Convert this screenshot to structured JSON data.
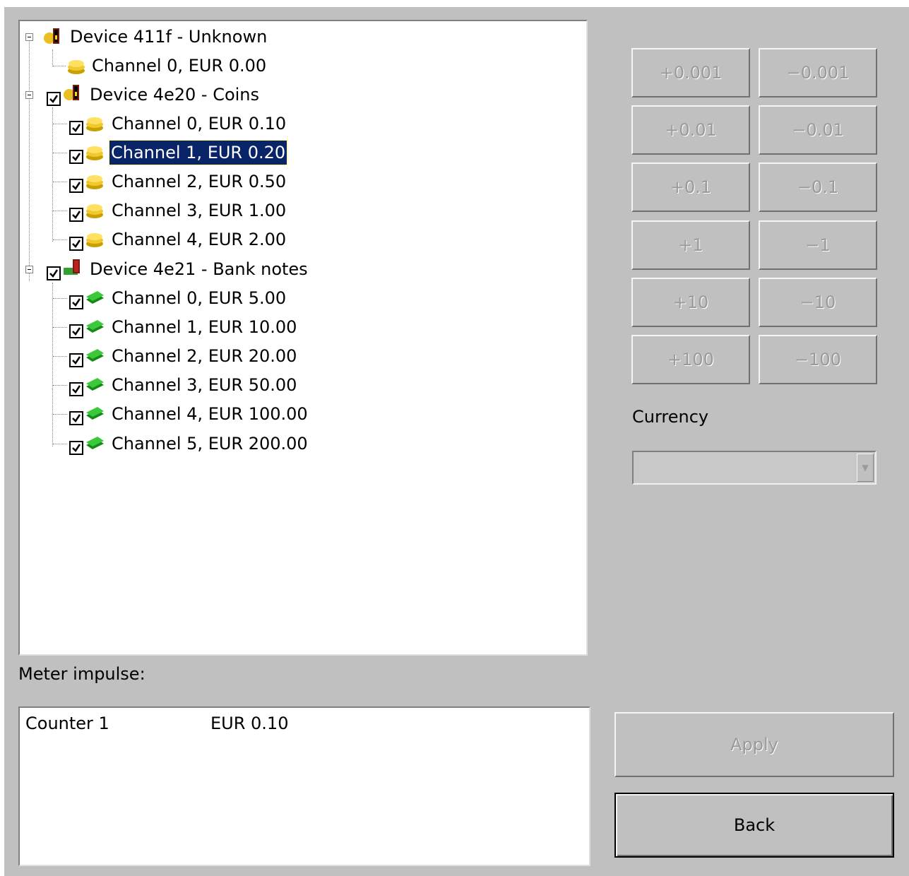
{
  "tree": {
    "devices": [
      {
        "label": "Device 411f - Unknown",
        "checkbox": false,
        "icon": "coin-device-icon",
        "channels": [
          {
            "label": "Channel 0, EUR 0.00",
            "checkbox": false,
            "icon": "coins-icon"
          }
        ]
      },
      {
        "label": "Device 4e20 - Coins",
        "checkbox": true,
        "icon": "coin-device-icon",
        "channels": [
          {
            "label": "Channel 0, EUR 0.10",
            "checkbox": true,
            "icon": "coins-icon"
          },
          {
            "label": "Channel 1, EUR 0.20",
            "checkbox": true,
            "icon": "coins-icon",
            "selected": true
          },
          {
            "label": "Channel 2, EUR 0.50",
            "checkbox": true,
            "icon": "coins-icon"
          },
          {
            "label": "Channel 3, EUR 1.00",
            "checkbox": true,
            "icon": "coins-icon"
          },
          {
            "label": "Channel 4, EUR 2.00",
            "checkbox": true,
            "icon": "coins-icon"
          }
        ]
      },
      {
        "label": "Device 4e21 - Bank notes",
        "checkbox": true,
        "icon": "banknote-device-icon",
        "channels": [
          {
            "label": "Channel 0, EUR 5.00",
            "checkbox": true,
            "icon": "banknotes-icon"
          },
          {
            "label": "Channel 1, EUR 10.00",
            "checkbox": true,
            "icon": "banknotes-icon"
          },
          {
            "label": "Channel 2, EUR 20.00",
            "checkbox": true,
            "icon": "banknotes-icon"
          },
          {
            "label": "Channel 3, EUR 50.00",
            "checkbox": true,
            "icon": "banknotes-icon"
          },
          {
            "label": "Channel 4, EUR 100.00",
            "checkbox": true,
            "icon": "banknotes-icon"
          },
          {
            "label": "Channel 5, EUR 200.00",
            "checkbox": true,
            "icon": "banknotes-icon"
          }
        ]
      }
    ]
  },
  "step_buttons": [
    {
      "plus": "+0.001",
      "minus": "−0.001"
    },
    {
      "plus": "+0.01",
      "minus": "−0.01"
    },
    {
      "plus": "+0.1",
      "minus": "−0.1"
    },
    {
      "plus": "+1",
      "minus": "−1"
    },
    {
      "plus": "+10",
      "minus": "−10"
    },
    {
      "plus": "+100",
      "minus": "−100"
    }
  ],
  "currency": {
    "label": "Currency",
    "value": ""
  },
  "meter": {
    "label": "Meter impulse:",
    "rows": [
      {
        "name": "Counter 1",
        "value": "EUR 0.10"
      }
    ]
  },
  "actions": {
    "apply": "Apply",
    "back": "Back"
  },
  "colors": {
    "window_bg": "#c0c0c0",
    "selection_bg": "#0a246a",
    "disabled_text": "#9a9a9a"
  }
}
